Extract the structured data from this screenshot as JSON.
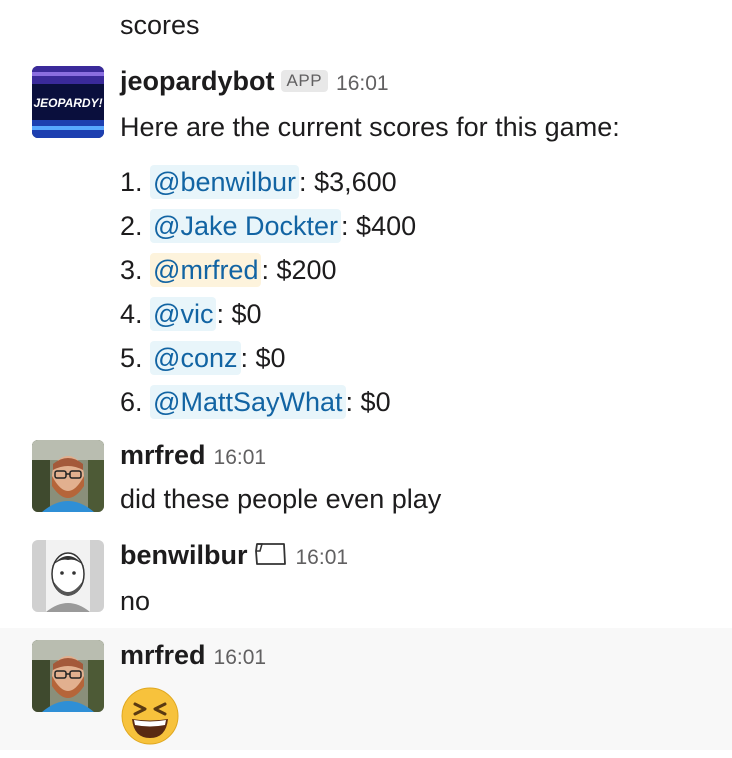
{
  "prev_text": "scores",
  "messages": [
    {
      "user": "jeopardybot",
      "badge": "APP",
      "time": "16:01",
      "intro": "Here are the current scores for this game:",
      "avatar_text": "JEOPARDY!",
      "scores": [
        {
          "rank": "1.",
          "mention": "@benwilbur",
          "sep": ":",
          "amount": "$3,600"
        },
        {
          "rank": "2.",
          "mention": "@Jake Dockter",
          "sep": ":",
          "amount": "$400"
        },
        {
          "rank": "3.",
          "mention": "@mrfred",
          "sep": ":",
          "amount": "$200"
        },
        {
          "rank": "4.",
          "mention": "@vic",
          "sep": ":",
          "amount": "$0"
        },
        {
          "rank": "5.",
          "mention": "@conz",
          "sep": ":",
          "amount": "$0"
        },
        {
          "rank": "6.",
          "mention": "@MattSayWhat",
          "sep": ":",
          "amount": "$0"
        }
      ]
    },
    {
      "user": "mrfred",
      "time": "16:01",
      "text": "did these people even play"
    },
    {
      "user": "benwilbur",
      "time": "16:01",
      "text": "no",
      "status_icon": "oregon-flag-icon"
    },
    {
      "user": "mrfred",
      "time": "16:01",
      "emoji": "laughing-squint-emoji"
    }
  ],
  "colors": {
    "mention": "#1264a3",
    "mention_bg": "#e8f5fa",
    "self_mention_bg": "#fdf3dc",
    "hover_bg": "#f8f8f8"
  }
}
